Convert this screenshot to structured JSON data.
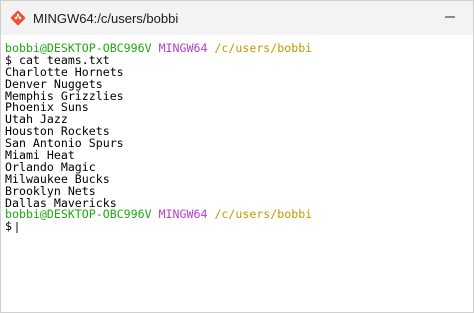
{
  "window": {
    "title": "MINGW64:/c/users/bobbi",
    "icon": "git-bash-icon",
    "controls": [
      "minimize-icon"
    ]
  },
  "prompt": {
    "user_host": "bobbi@DESKTOP-OBC996V",
    "env": "MINGW64",
    "path": "/c/users/bobbi",
    "symbol": "$"
  },
  "terminal": {
    "command": "$ cat teams.txt",
    "output": [
      "Charlotte Hornets",
      "Denver Nuggets",
      "Memphis Grizzlies",
      "Phoenix Suns",
      "Utah Jazz",
      "Houston Rockets",
      "San Antonio Spurs",
      "Miami Heat",
      "Orlando Magic",
      "Milwaukee Bucks",
      "Brooklyn Nets",
      "Dallas Mavericks"
    ]
  },
  "colors": {
    "user": "#1ea80f",
    "env": "#b03fc6",
    "path": "#bf9b00"
  }
}
